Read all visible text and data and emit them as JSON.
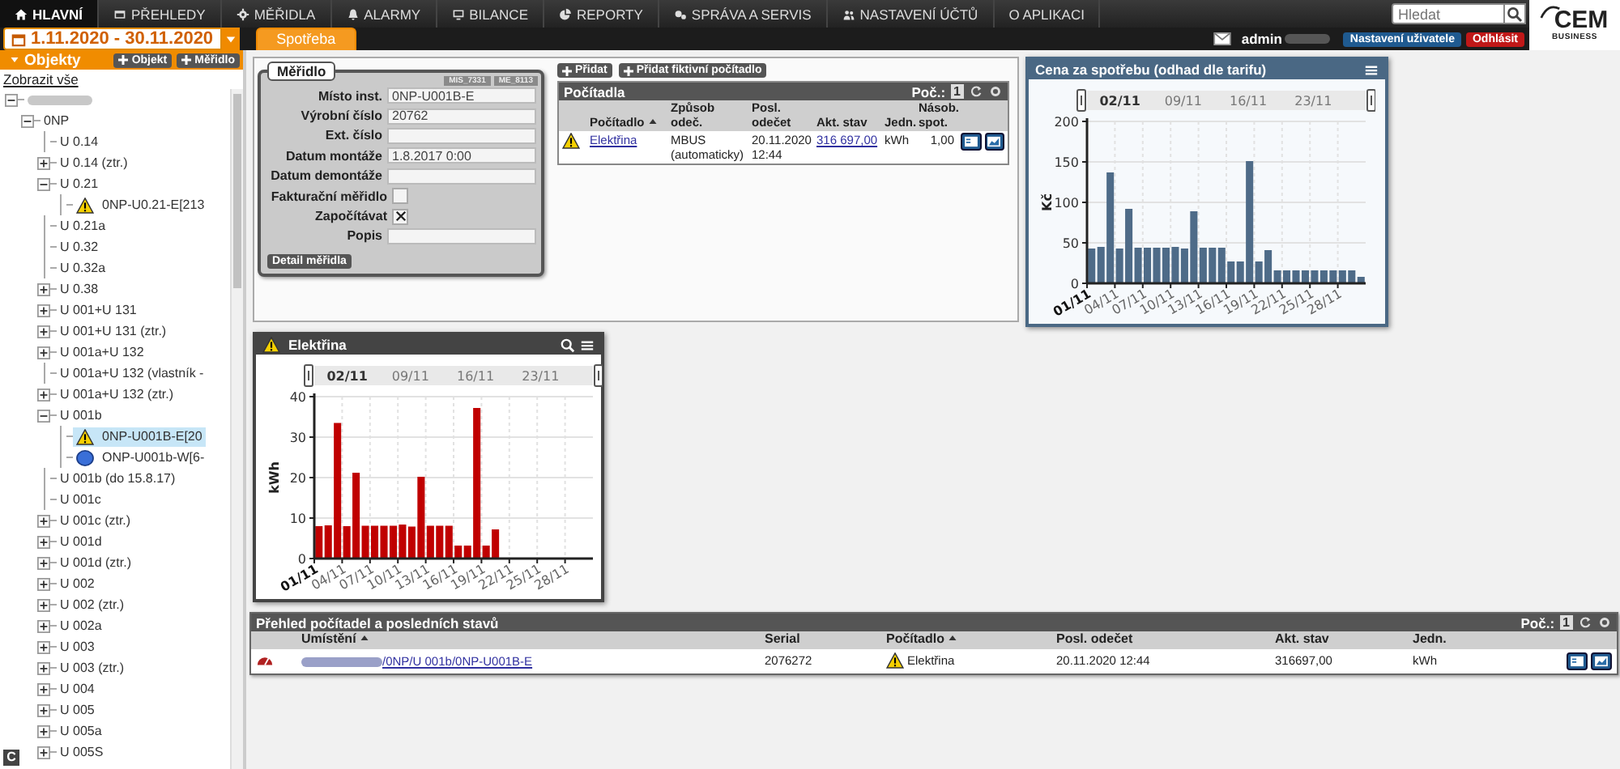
{
  "nav": {
    "items": [
      {
        "label": "HLAVNÍ",
        "selected": true
      },
      {
        "label": "PŘEHLEDY",
        "selected": false
      },
      {
        "label": "MĚŘIDLA",
        "selected": false
      },
      {
        "label": "ALARMY",
        "selected": false
      },
      {
        "label": "BILANCE",
        "selected": false
      },
      {
        "label": "REPORTY",
        "selected": false
      },
      {
        "label": "SPRÁVA A SERVIS",
        "selected": false
      },
      {
        "label": "NASTAVENÍ ÚČTŮ",
        "selected": false
      },
      {
        "label": "O APLIKACI",
        "selected": false
      }
    ],
    "search": {
      "placeholder": "Hledat"
    },
    "logo": {
      "name": "CEM",
      "tagline": "BUSINESS"
    }
  },
  "toolbar": {
    "date_range": "1.11.2020 - 30.11.2020",
    "tabs": [
      {
        "label": "Spotřeba",
        "selected": true
      }
    ],
    "user": "admin",
    "buttons": [
      "Nastavení uživatele",
      "Odhlásit"
    ]
  },
  "sidebar": {
    "title": "Objekty",
    "buttons": [
      "Objekt",
      "Měřidlo"
    ],
    "show_all": "Zobrazit vše",
    "corner_button": "C",
    "tree": [
      {
        "expanded": true,
        "selected": false,
        "children": [
          {
            "label": "0NP",
            "expanded": true,
            "selected": false,
            "children": [
              {
                "label": "U 0.14",
                "selected": false
              },
              {
                "label": "U 0.14 (ztr.)",
                "expanded": false,
                "selected": false
              },
              {
                "label": "U 0.21",
                "expanded": true,
                "selected": false,
                "children": [
                  {
                    "kind": "warning",
                    "label": "0NP-U0.21-E[213",
                    "selected": false
                  }
                ]
              },
              {
                "label": "U 0.21a",
                "selected": false
              },
              {
                "label": "U 0.32",
                "selected": false
              },
              {
                "label": "U 0.32a",
                "selected": false
              },
              {
                "label": "U 0.38",
                "expanded": false,
                "selected": false
              },
              {
                "label": "U 001+U 131",
                "expanded": false,
                "selected": false
              },
              {
                "label": "U 001+U 131 (ztr.)",
                "expanded": false,
                "selected": false
              },
              {
                "label": "U 001a+U 132",
                "expanded": false,
                "selected": false
              },
              {
                "label": "U 001a+U 132 (vlastník -",
                "selected": false
              },
              {
                "label": "U 001a+U 132 (ztr.)",
                "expanded": false,
                "selected": false
              },
              {
                "label": "U 001b",
                "expanded": true,
                "selected": false,
                "children": [
                  {
                    "kind": "warning",
                    "label": "0NP-U001B-E[20",
                    "selected": true
                  },
                  {
                    "kind": "meter",
                    "label": "ONP-U001b-W[6-",
                    "selected": false
                  }
                ]
              },
              {
                "label": "U 001b (do 15.8.17)",
                "selected": false
              },
              {
                "label": "U 001c",
                "selected": false
              },
              {
                "label": "U 001c (ztr.)",
                "expanded": false,
                "selected": false
              },
              {
                "label": "U 001d",
                "expanded": false,
                "selected": false
              },
              {
                "label": "U 001d (ztr.)",
                "expanded": false,
                "selected": false
              },
              {
                "label": "U 002",
                "expanded": false,
                "selected": false
              },
              {
                "label": "U 002 (ztr.)",
                "expanded": false,
                "selected": false
              },
              {
                "label": "U 002a",
                "expanded": false,
                "selected": false
              },
              {
                "label": "U 003",
                "expanded": false,
                "selected": false
              },
              {
                "label": "U 003 (ztr.)",
                "expanded": false,
                "selected": false
              },
              {
                "label": "U 004",
                "expanded": false,
                "selected": false
              },
              {
                "label": "U 005",
                "expanded": false,
                "selected": false
              },
              {
                "label": "U 005a",
                "expanded": false,
                "selected": false
              },
              {
                "label": "U 005S",
                "expanded": false,
                "selected": false
              }
            ]
          }
        ]
      }
    ]
  },
  "meter": {
    "title": "Měřidlo",
    "codes": [
      "MIS_7331",
      "ME_8113"
    ],
    "button": "Detail měřidla",
    "fields": [
      {
        "label": "Místo inst.",
        "kind": "text",
        "value": "0NP-U001B-E"
      },
      {
        "label": "Výrobní číslo",
        "kind": "text",
        "value": "20762"
      },
      {
        "label": "Ext. číslo",
        "kind": "text"
      },
      {
        "label": "Datum montáže",
        "kind": "text",
        "value": "1.8.2017 0:00"
      },
      {
        "label": "Datum demontáže",
        "kind": "text"
      },
      {
        "label": "Fakturační měřidlo",
        "kind": "checkbox",
        "checked": false
      },
      {
        "label": "Započítávat",
        "kind": "checkbox",
        "checked": true
      },
      {
        "label": "Popis",
        "kind": "text"
      }
    ]
  },
  "counters": {
    "buttons": [
      "Přidat",
      "Přidat fiktivní počítadlo"
    ],
    "title": "Počítadla",
    "count_label": "Poč.:",
    "count": "1",
    "columns": [
      {
        "label": "Počítadlo",
        "sorted": true
      },
      {
        "label": "Způsob odeč.",
        "sorted": false
      },
      {
        "label": "Posl. odečet",
        "sorted": false
      },
      {
        "label": "Akt. stav",
        "sorted": false
      },
      {
        "label": "Jedn.",
        "sorted": false
      },
      {
        "label": "Násob. spot.",
        "sorted": false
      }
    ],
    "rows": [
      {
        "warning": true,
        "name": "Elektřina",
        "method": "MBUS (automaticky)",
        "last_reading": "20.11.2020 12:44",
        "state": "316 697,00",
        "unit": "kWh",
        "multiplier": "1,00"
      }
    ]
  },
  "price_chart": {
    "title": "Cena za spotřebu (odhad dle tarifu)",
    "navigator_labels": [
      "02/11",
      "09/11",
      "16/11",
      "23/11"
    ],
    "chart_data": {
      "type": "bar",
      "ylabel": "Kč",
      "grid": true,
      "categories": [
        "01/11",
        null,
        null,
        "04/11",
        null,
        null,
        "07/11",
        null,
        null,
        "10/11",
        null,
        null,
        "13/11",
        null,
        null,
        "16/11",
        null,
        null,
        "19/11",
        null,
        null,
        "22/11",
        null,
        null,
        "25/11",
        null,
        null,
        "28/11",
        null,
        null
      ],
      "series": [
        {
          "color": "#4e6b88",
          "values": [
            43,
            45,
            137,
            43,
            92,
            44,
            44,
            44,
            44,
            45,
            43,
            89,
            44,
            44,
            44,
            27,
            27,
            151,
            27,
            41,
            16,
            16,
            16,
            16,
            16,
            16,
            16,
            16,
            16,
            8
          ]
        }
      ],
      "ylim": [
        0,
        200
      ],
      "yticks": [
        0,
        50,
        100,
        150,
        200
      ]
    }
  },
  "energy_chart": {
    "title": "Elektřina",
    "warning": true,
    "navigator_labels": [
      "02/11",
      "09/11",
      "16/11",
      "23/11"
    ],
    "chart_data": {
      "type": "bar",
      "ylabel": "kWh",
      "grid": true,
      "categories": [
        "01/11",
        null,
        null,
        "04/11",
        null,
        null,
        "07/11",
        null,
        null,
        "10/11",
        null,
        null,
        "13/11",
        null,
        null,
        "16/11",
        null,
        null,
        "19/11",
        null,
        null,
        "22/11",
        null,
        null,
        "25/11",
        null,
        null,
        "28/11",
        null,
        null
      ],
      "series": [
        {
          "color": "#c00000",
          "values": [
            8,
            8.2,
            33.5,
            8,
            21.2,
            8.1,
            8.1,
            8.1,
            8.1,
            8.4,
            7.9,
            20.2,
            8.1,
            8.1,
            8.1,
            3.2,
            3.2,
            37.2,
            3.2,
            7.2,
            null,
            null,
            null,
            null,
            null,
            null,
            null,
            null,
            null,
            null
          ]
        }
      ],
      "ylim": [
        0,
        40
      ],
      "yticks": [
        0,
        10,
        20,
        30,
        40
      ]
    }
  },
  "overview": {
    "title": "Přehled počítadel a posledních stavů",
    "count_label": "Poč.:",
    "count": "1",
    "columns": [
      {
        "label": "Umístění",
        "sorted": true
      },
      {
        "label": "Serial",
        "sorted": false
      },
      {
        "label": "Počítadlo",
        "sorted": true
      },
      {
        "label": "Posl. odečet",
        "sorted": false
      },
      {
        "label": "Akt. stav",
        "sorted": false
      },
      {
        "label": "Jedn.",
        "sorted": false
      }
    ],
    "rows": [
      {
        "location": "/0NP/U 001b/0NP-U001B-E",
        "serial": "2076272",
        "warning": true,
        "counter": "Elektřina",
        "last_reading": "20.11.2020 12:44",
        "state": "316697,00",
        "unit": "kWh"
      }
    ]
  }
}
